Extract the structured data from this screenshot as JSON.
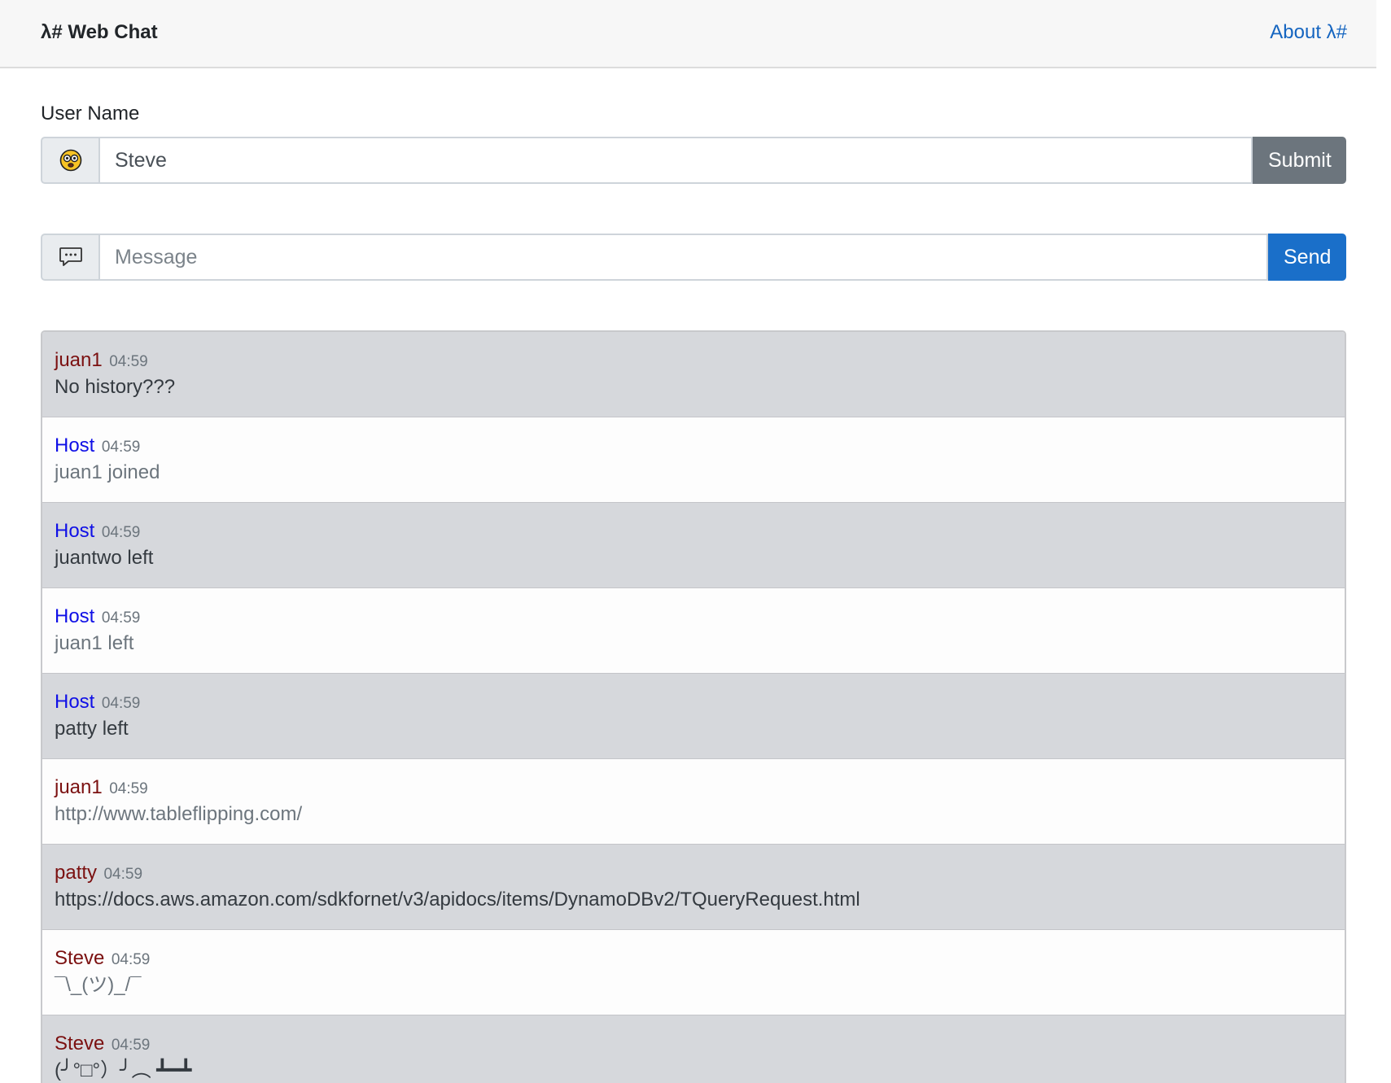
{
  "navbar": {
    "brand": "λ# Web Chat",
    "about": "About λ#"
  },
  "user_form": {
    "label": "User Name",
    "icon": "face-emoji-icon",
    "value": "Steve",
    "submit_label": "Submit"
  },
  "message_form": {
    "icon": "speech-bubble-icon",
    "placeholder": "Message",
    "send_label": "Send"
  },
  "colors": {
    "user_name": "#7b1010",
    "host_name": "#1010e6",
    "send_button": "#1a6fc9",
    "submit_button": "#6c757d"
  },
  "messages": [
    {
      "author": "juan1",
      "time": "04:59",
      "text": "No history???"
    },
    {
      "author": "Host",
      "time": "04:59",
      "text": "juan1 joined"
    },
    {
      "author": "Host",
      "time": "04:59",
      "text": "juantwo left"
    },
    {
      "author": "Host",
      "time": "04:59",
      "text": "juan1 left"
    },
    {
      "author": "Host",
      "time": "04:59",
      "text": "patty left"
    },
    {
      "author": "juan1",
      "time": "04:59",
      "text": "http://www.tableflipping.com/"
    },
    {
      "author": "patty",
      "time": "04:59",
      "text": "https://docs.aws.amazon.com/sdkfornet/v3/apidocs/items/DynamoDBv2/TQueryRequest.html"
    },
    {
      "author": "Steve",
      "time": "04:59",
      "text": "¯\\_(ツ)_/¯"
    },
    {
      "author": "Steve",
      "time": "04:59",
      "text": "(╯°□°）╯︵ ┻━┻"
    }
  ]
}
